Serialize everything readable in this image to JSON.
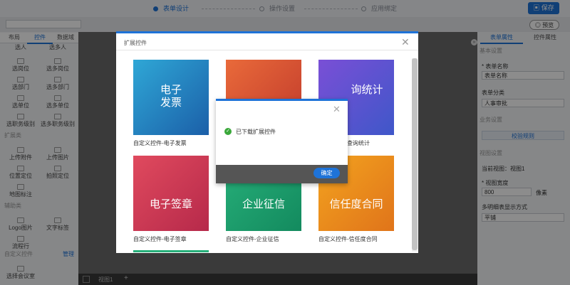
{
  "steps": [
    {
      "label": "表单设计",
      "active": true
    },
    {
      "label": "操作设置",
      "active": false
    },
    {
      "label": "应用绑定",
      "active": false
    }
  ],
  "toolbar": {
    "save_label": "保存",
    "preview_label": "预览"
  },
  "left_panel": {
    "tabs": [
      "布局",
      "控件",
      "数据域"
    ],
    "active_tab": "控件",
    "top_row": [
      "选人",
      "选多人"
    ],
    "rows": [
      [
        "选岗位",
        "选多岗位"
      ],
      [
        "选部门",
        "选多部门"
      ],
      [
        "选单位",
        "选多单位"
      ],
      [
        "选职务级别",
        "选多职务级别"
      ]
    ],
    "ext_section": "扩展类",
    "ext_rows": [
      [
        "上传附件",
        "上传图片"
      ],
      [
        "位置定位",
        "拍照定位"
      ],
      [
        "地图标注",
        ""
      ]
    ],
    "aux_section": "辅助类",
    "aux_rows": [
      [
        "Logo图片",
        "文字标签"
      ],
      [
        "流程行",
        ""
      ]
    ],
    "custom_section": "自定义控件",
    "manage_label": "管理",
    "custom_items": [
      "选择会议室"
    ]
  },
  "canvas": {
    "view_tab": "视图1"
  },
  "right_panel": {
    "tabs": [
      "表单属性",
      "控件属性"
    ],
    "active_tab": "表单属性",
    "basic_section": "基本设置",
    "form_name_label": "* 表单名称",
    "form_name_value": "表单名称",
    "form_category_label": "表单分类",
    "form_category_value": "人事审批",
    "business_section": "业务设置",
    "validation_button": "校验规则",
    "view_section": "视图设置",
    "current_view_label": "当前视图：",
    "current_view_value": "视图1",
    "view_width_label": "* 视图宽度",
    "view_width_value": "800",
    "view_width_unit": "像素",
    "detail_display_label": "多明细表显示方式",
    "detail_display_value": "平铺"
  },
  "dialog": {
    "title": "扩展控件",
    "cards": [
      {
        "label": "自定义控件-电子发票",
        "text": "电子\n发票",
        "color_from": "#2fa7d6",
        "color_to": "#1b5fa8"
      },
      {
        "label": "",
        "text": "",
        "color_from": "#e96a3a",
        "color_to": "#c0392b"
      },
      {
        "label": "查询统计",
        "text": "询统计",
        "color_from": "#7a4fd6",
        "color_to": "#3f57c9"
      },
      {
        "label": "自定义控件-电子签章",
        "text": "电子签章",
        "color_from": "#e04a5e",
        "color_to": "#b6294a"
      },
      {
        "label": "自定义控件-企业征信",
        "text": "企业征信",
        "color_from": "#27b07a",
        "color_to": "#138a5e"
      },
      {
        "label": "自定义控件-信任度合同",
        "text": "信任度合同",
        "color_from": "#f3a31f",
        "color_to": "#e0741a"
      }
    ]
  },
  "alert": {
    "message": "已下载扩展控件",
    "ok_label": "确定"
  },
  "colors": {
    "accent": "#1e73d8",
    "success": "#3aa83a"
  }
}
